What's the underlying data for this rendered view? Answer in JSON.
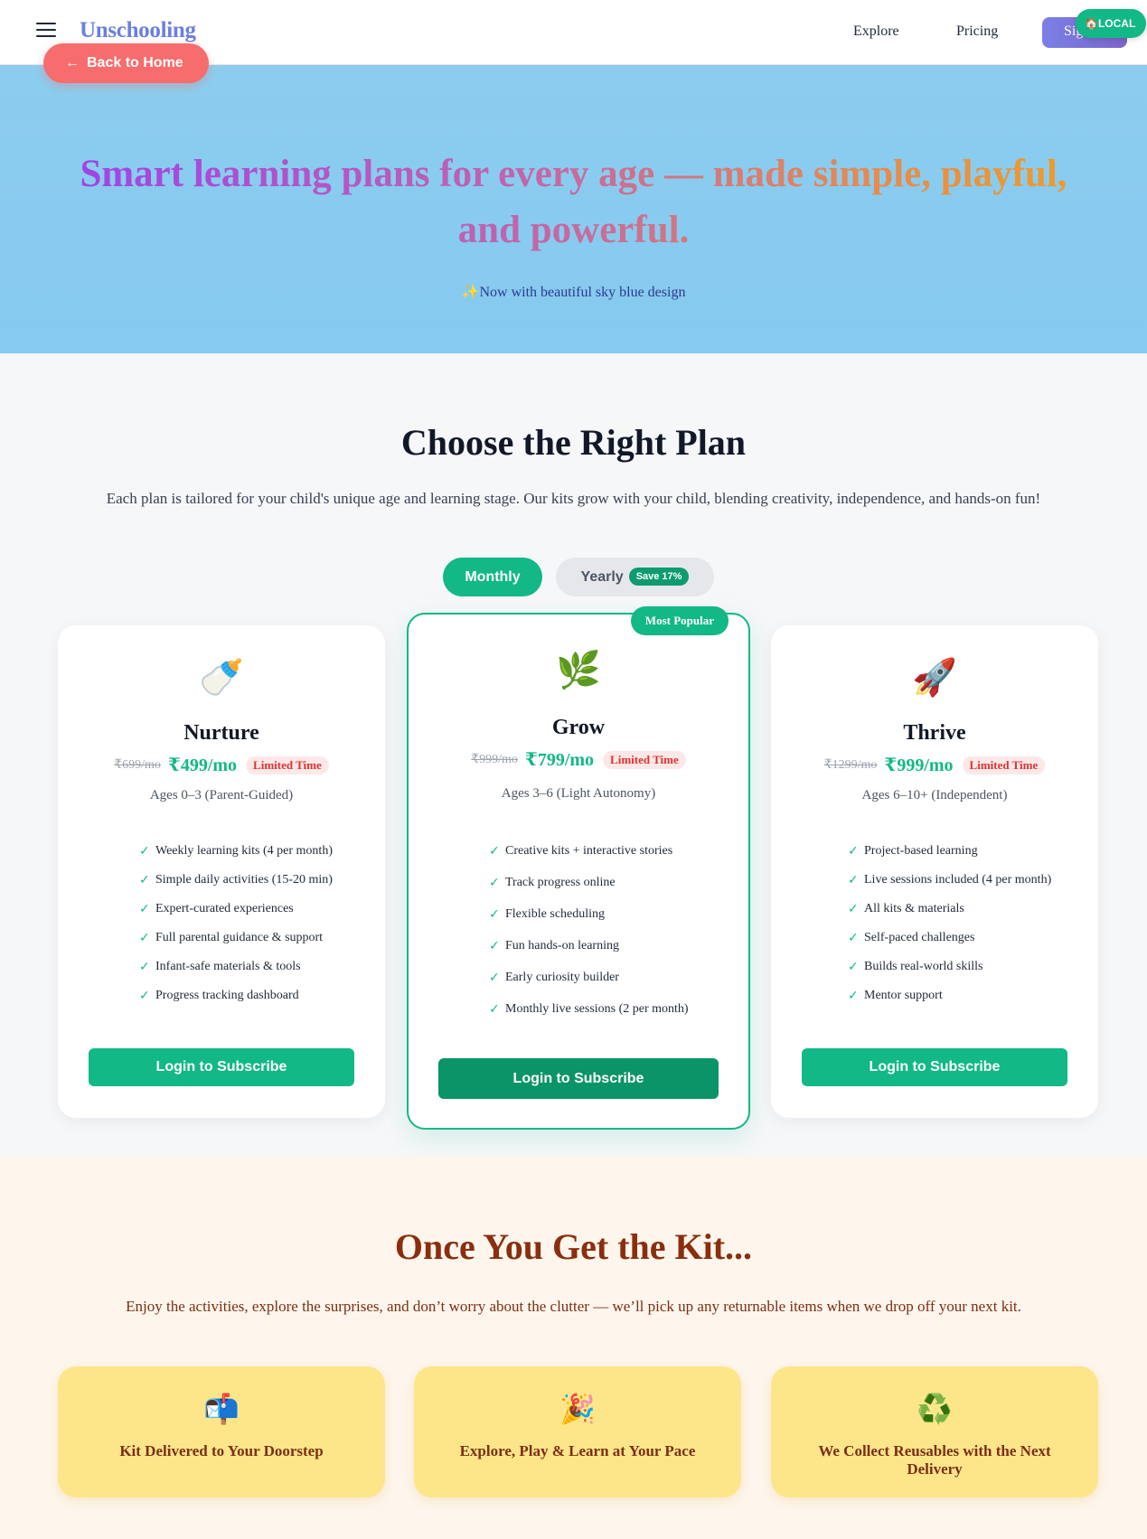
{
  "header": {
    "brand": "Unschooling",
    "nav": {
      "explore": "Explore",
      "pricing": "Pricing"
    },
    "signin_label": "Sign In",
    "local_badge": "🏠LOCAL",
    "back_button": "Back to Home"
  },
  "hero": {
    "title": "Smart learning plans for every age — made simple, playful, and powerful.",
    "subtitle": "✨Now with beautiful sky blue design"
  },
  "plans_section": {
    "title": "Choose the Right Plan",
    "description": "Each plan is tailored for your child's unique age and learning stage. Our kits grow with your child, blending creativity, independence, and hands-on fun!",
    "toggle": {
      "monthly": "Monthly",
      "yearly": "Yearly",
      "save_badge": "Save 17%",
      "selected": "Monthly"
    },
    "plans": [
      {
        "icon": "🍼",
        "name": "Nurture",
        "old_price": "₹699/mo",
        "price": "₹499/mo",
        "badge": "Limited Time",
        "ages": "Ages 0–3 (Parent-Guided)",
        "features": [
          "Weekly learning kits (4 per month)",
          "Simple daily activities (15-20 min)",
          "Expert-curated experiences",
          "Full parental guidance & support",
          "Infant-safe materials & tools",
          "Progress tracking dashboard"
        ],
        "cta": "Login to Subscribe"
      },
      {
        "icon": "🌿",
        "name": "Grow",
        "popular_label": "Most Popular",
        "old_price": "₹999/mo",
        "price": "₹799/mo",
        "badge": "Limited Time",
        "ages": "Ages 3–6 (Light Autonomy)",
        "features": [
          "Creative kits + interactive stories",
          "Track progress online",
          "Flexible scheduling",
          "Fun hands-on learning",
          "Early curiosity builder",
          "Monthly live sessions (2 per month)"
        ],
        "cta": "Login to Subscribe"
      },
      {
        "icon": "🚀",
        "name": "Thrive",
        "old_price": "₹1299/mo",
        "price": "₹999/mo",
        "badge": "Limited Time",
        "ages": "Ages 6–10+ (Independent)",
        "features": [
          "Project-based learning",
          "Live sessions included (4 per month)",
          "All kits & materials",
          "Self-paced challenges",
          "Builds real-world skills",
          "Mentor support"
        ],
        "cta": "Login to Subscribe"
      }
    ],
    "check_glyph": "✓"
  },
  "kit_section": {
    "title": "Once You Get the Kit...",
    "description": "Enjoy the activities, explore the surprises, and don’t worry about the clutter — we’ll pick up any returnable items when we drop off your next kit.",
    "steps": [
      {
        "icon": "📬",
        "label": "Kit Delivered to Your Doorstep"
      },
      {
        "icon": "🎉",
        "label": "Explore, Play & Learn at Your Pace"
      },
      {
        "icon": "♻️",
        "label": "We Collect Reusables with the Next Delivery"
      }
    ]
  },
  "colors": {
    "accent": "#12b886",
    "hero_bg": "#87cbf0",
    "back_button": "#f76c6c",
    "kit_card": "#fde68a",
    "kit_text": "#7a2e14"
  }
}
